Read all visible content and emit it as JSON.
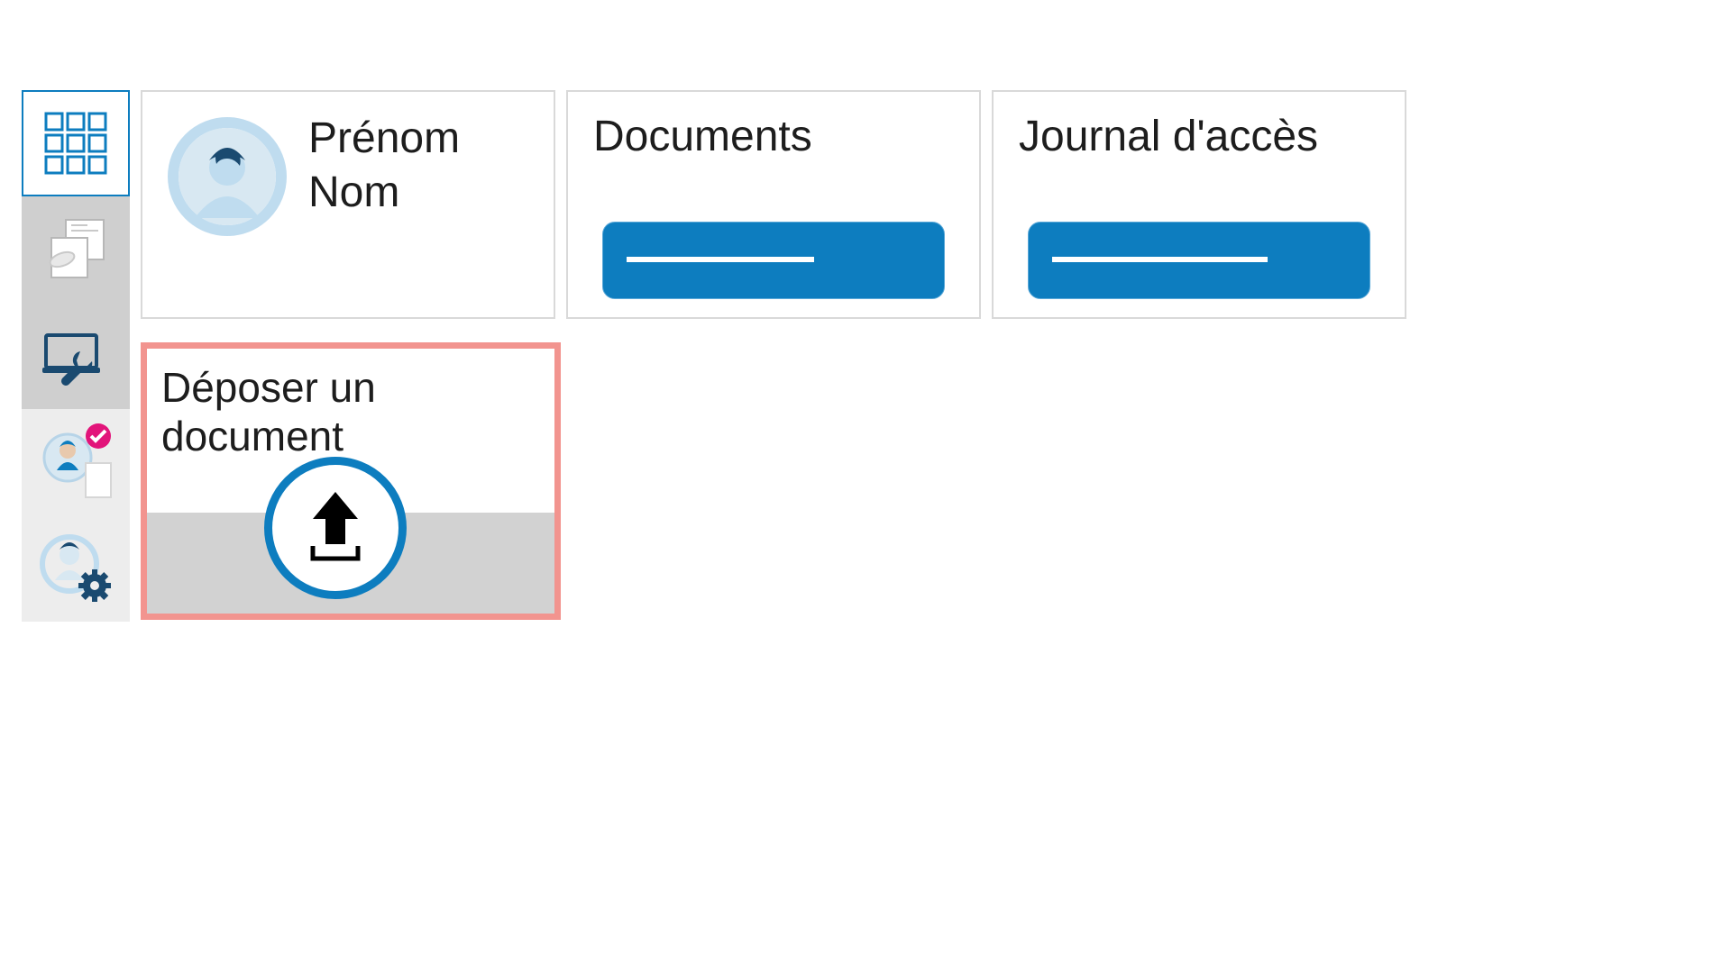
{
  "sidebar": {
    "items": [
      {
        "icon": "app-grid-icon"
      },
      {
        "icon": "documents-pill-icon"
      },
      {
        "icon": "laptop-wrench-icon"
      },
      {
        "icon": "person-check-icon"
      },
      {
        "icon": "person-gear-icon"
      }
    ]
  },
  "patient": {
    "line1": "Prénom",
    "line2": "Nom"
  },
  "cards": {
    "documents_title": "Documents",
    "access_log_title": "Journal d'accès"
  },
  "upload": {
    "title": "Déposer un document"
  },
  "colors": {
    "accent": "#0d7dbf",
    "highlight": "#f2948f"
  }
}
